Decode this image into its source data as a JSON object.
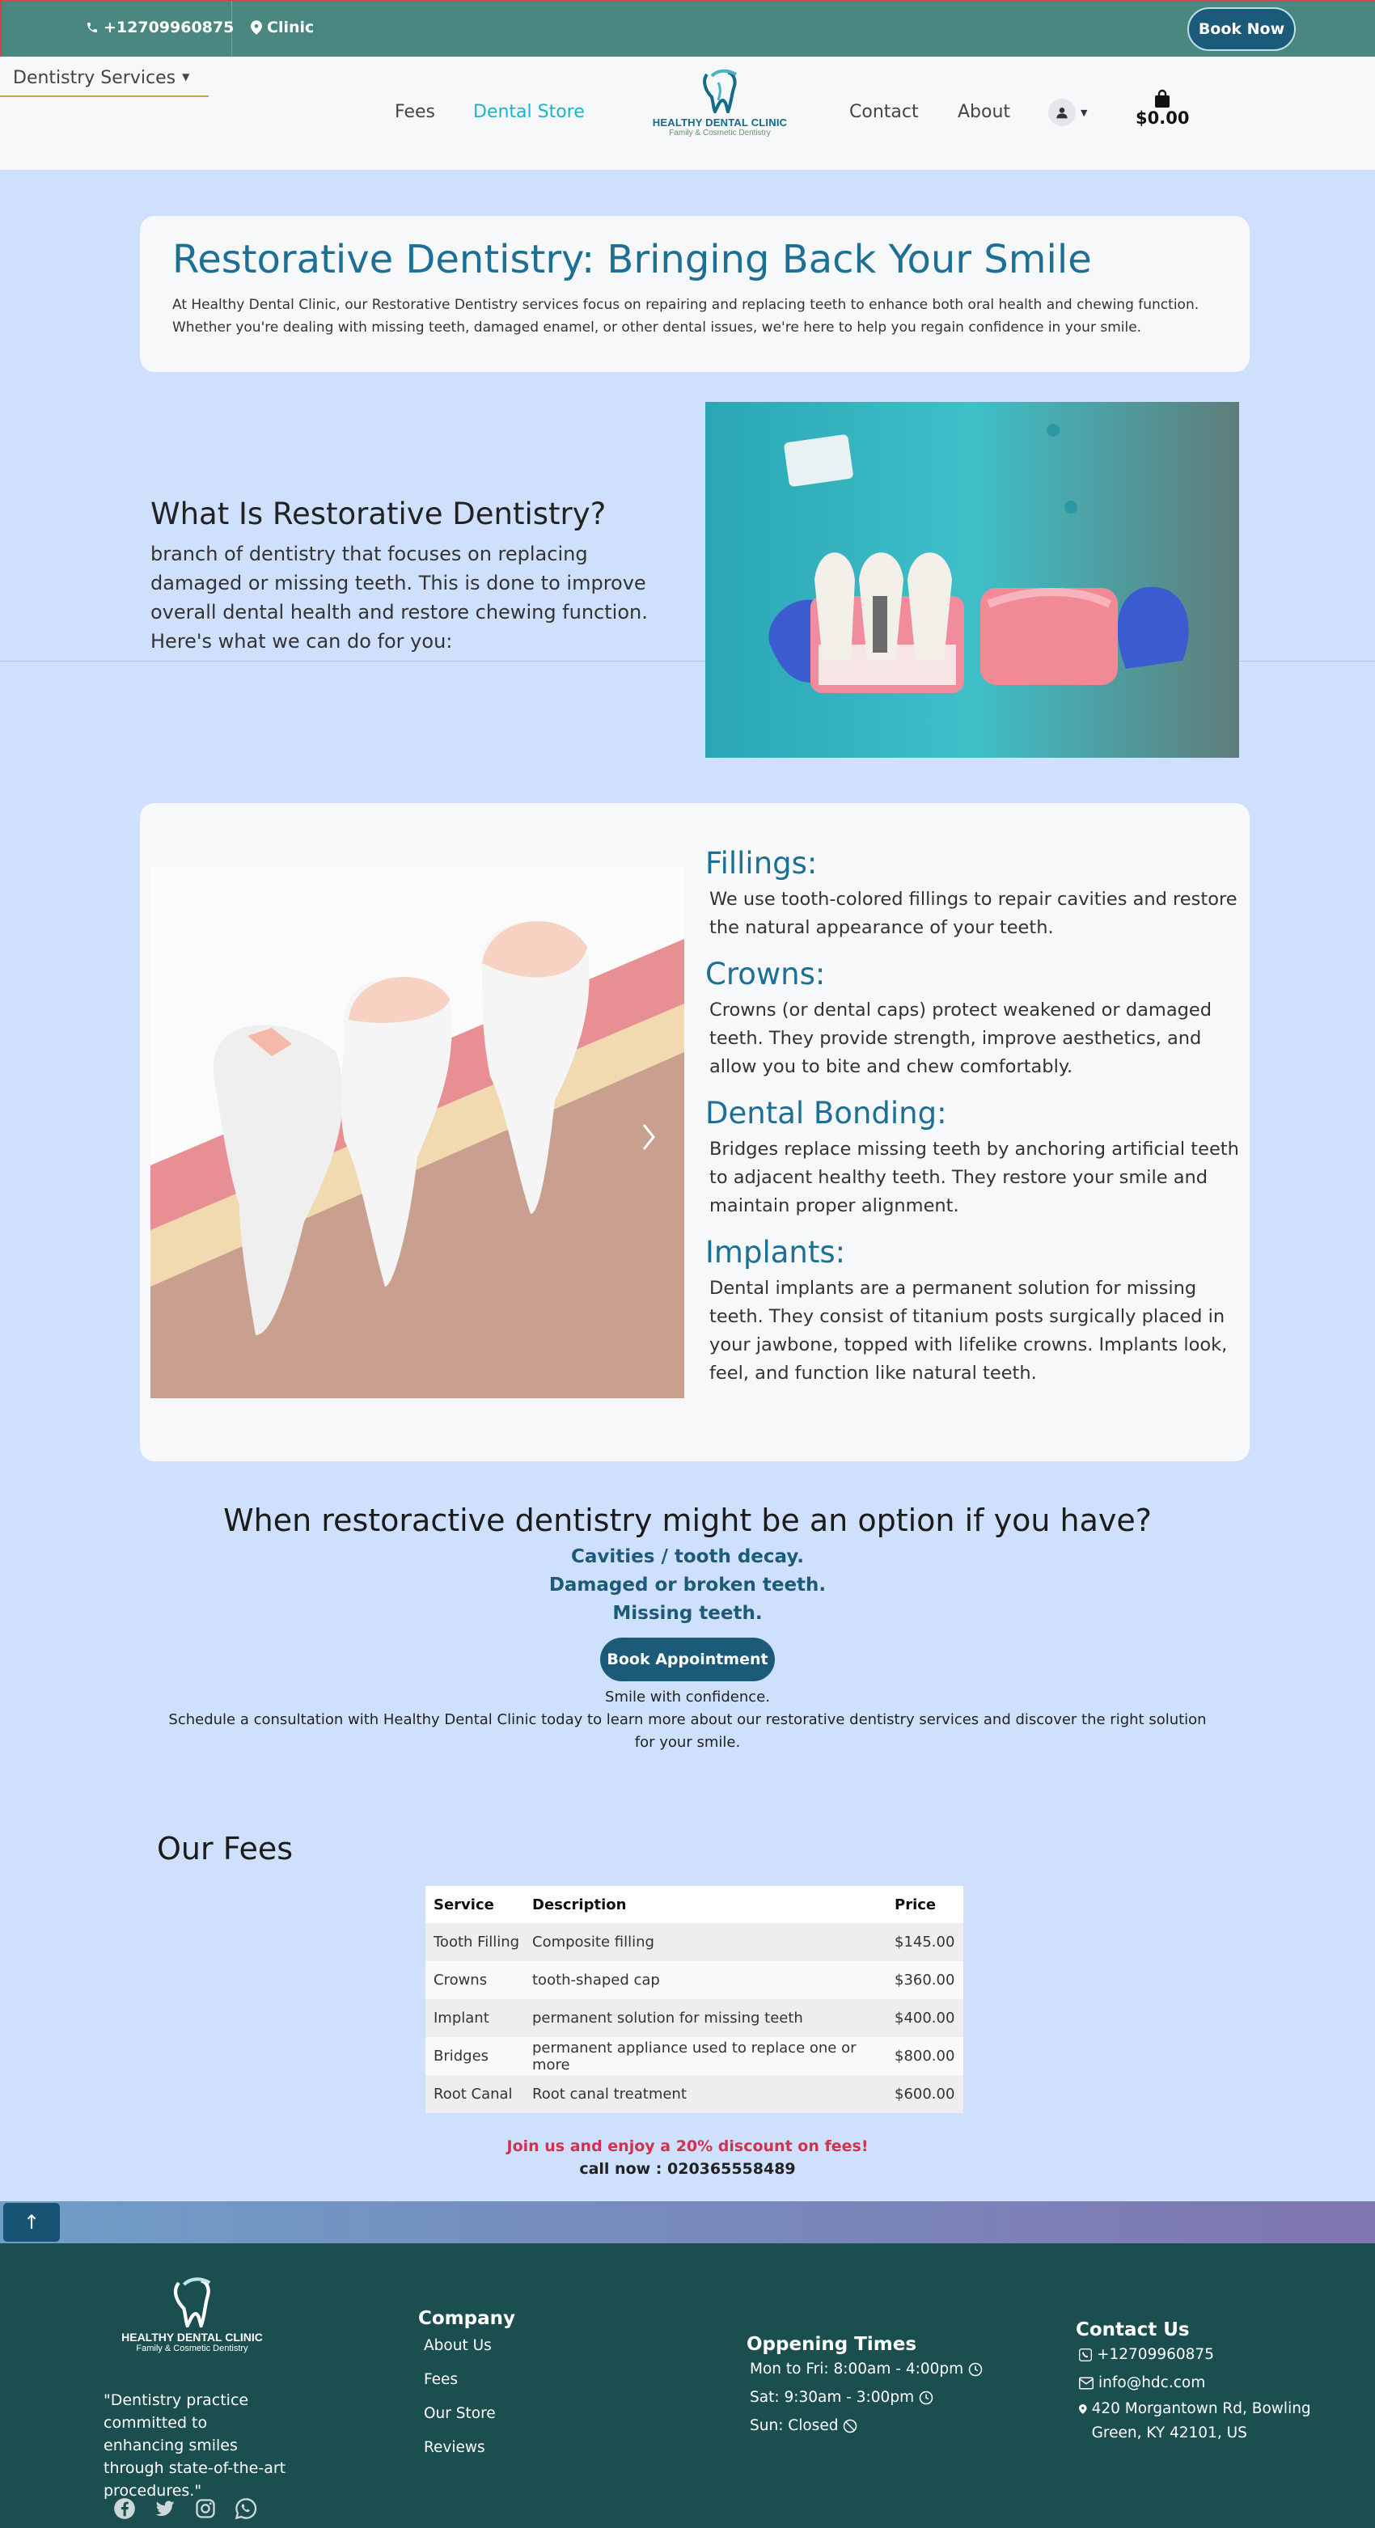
{
  "topbar": {
    "phone": "+12709960875",
    "clinic": "Clinic",
    "book_now": "Book Now"
  },
  "nav": {
    "services": "Dentistry Services",
    "fees": "Fees",
    "store": "Dental Store",
    "contact": "Contact",
    "about": "About",
    "cart_total": "$0.00"
  },
  "logo": {
    "brand": "HEALTHY DENTAL CLINIC",
    "tagline": "Family & Cosmetic Dentistry"
  },
  "intro": {
    "title": "Restorative Dentistry: Bringing Back Your Smile",
    "text": "At Healthy Dental Clinic, our Restorative Dentistry services focus on repairing and replacing teeth to enhance both oral health and chewing function. Whether you're dealing with missing teeth, damaged enamel, or other dental issues, we're here to help you regain confidence in your smile."
  },
  "what": {
    "title": "What Is Restorative Dentistry?",
    "text": "branch of dentistry that focuses on replacing damaged or missing teeth. This is done to improve overall dental health and restore chewing function. Here's what we can do for you:"
  },
  "services": [
    {
      "title": "Fillings:",
      "text": "We use tooth-colored fillings to repair cavities and restore the natural appearance of your teeth."
    },
    {
      "title": "Crowns:",
      "text": "Crowns (or dental caps) protect weakened or damaged teeth. They provide strength, improve aesthetics, and allow you to bite and chew comfortably."
    },
    {
      "title": "Dental Bonding:",
      "text": "Bridges replace missing teeth by anchoring artificial teeth to adjacent healthy teeth. They restore your smile and maintain proper alignment."
    },
    {
      "title": "Implants:",
      "text": "Dental implants are a permanent solution for missing teeth. They consist of titanium posts surgically placed in your jawbone, topped with lifelike crowns. Implants look, feel, and function like natural teeth."
    }
  ],
  "when": {
    "title": "When restoractive dentistry might be an option if you have?",
    "conditions": [
      "Cavities / tooth decay.",
      "Damaged or broken teeth.",
      "Missing teeth."
    ],
    "button": "Book Appointment",
    "line1": "Smile with confidence.",
    "line2": "Schedule a consultation with Healthy Dental Clinic today to learn more about our restorative dentistry services and discover the right solution for your smile."
  },
  "fees": {
    "title": "Our Fees",
    "headers": [
      "Service",
      "Description",
      "Price"
    ],
    "rows": [
      [
        "Tooth Filling",
        "Composite filling",
        "$145.00"
      ],
      [
        "Crowns",
        "tooth-shaped cap",
        "$360.00"
      ],
      [
        "Implant",
        "permanent solution for missing teeth",
        "$400.00"
      ],
      [
        "Bridges",
        "permanent appliance used to replace one or more",
        "$800.00"
      ],
      [
        "Root Canal",
        "Root canal treatment",
        "$600.00"
      ]
    ],
    "promo": "Join us and enjoy a 20% discount on fees!",
    "call": "call now : 020365558489"
  },
  "footer": {
    "quote": "\"Dentistry practice committed to enhancing smiles through state-of-the-art procedures.\"",
    "company_title": "Company",
    "company_links": [
      "About Us",
      "Fees",
      "Our Store",
      "Reviews"
    ],
    "hours_title": "Oppening Times",
    "hours": [
      "Mon to Fri: 8:00am - 4:00pm",
      "Sat: 9:30am - 3:00pm",
      "Sun: Closed"
    ],
    "contact_title": "Contact Us",
    "phone": "+12709960875",
    "email": "info@hdc.com",
    "address": "420 Morgantown Rd, Bowling Green, KY 42101, US"
  }
}
